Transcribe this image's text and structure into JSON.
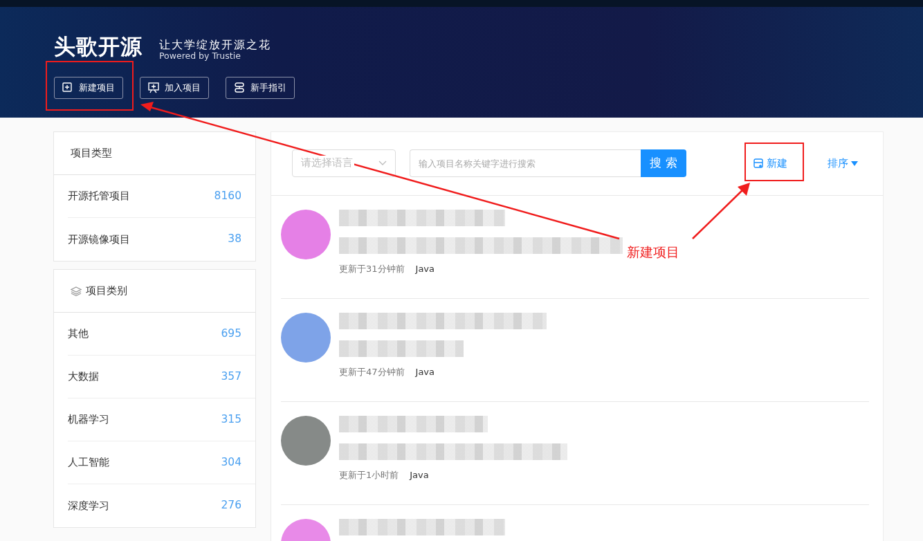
{
  "header": {
    "logo": "头歌开源",
    "slogan": "让大学绽放开源之花",
    "powered": "Powered by Trustie",
    "buttons": [
      {
        "label": "新建项目"
      },
      {
        "label": "加入项目"
      },
      {
        "label": "新手指引"
      }
    ]
  },
  "sidebar": {
    "sections": [
      {
        "title": "项目类型",
        "items": [
          {
            "label": "开源托管项目",
            "count": "8160"
          },
          {
            "label": "开源镜像项目",
            "count": "38"
          }
        ]
      },
      {
        "title": "项目类别",
        "items": [
          {
            "label": "其他",
            "count": "695"
          },
          {
            "label": "大数据",
            "count": "357"
          },
          {
            "label": "机器学习",
            "count": "315"
          },
          {
            "label": "人工智能",
            "count": "304"
          },
          {
            "label": "深度学习",
            "count": "276"
          }
        ]
      }
    ]
  },
  "toolbar": {
    "language_placeholder": "请选择语言",
    "search_placeholder": "输入项目名称关键字进行搜索",
    "search_button": "搜 索",
    "new_button": "新建",
    "sort": "排序"
  },
  "projects": [
    {
      "color": "#e580e6",
      "updated": "更新于31分钟前",
      "language": "Java"
    },
    {
      "color": "#7ea3e8",
      "updated": "更新于47分钟前",
      "language": "Java"
    },
    {
      "color": "#868a88",
      "updated": "更新于1小时前",
      "language": "Java"
    },
    {
      "color": "#e88ae8"
    }
  ],
  "annotation": {
    "label": "新建项目"
  }
}
